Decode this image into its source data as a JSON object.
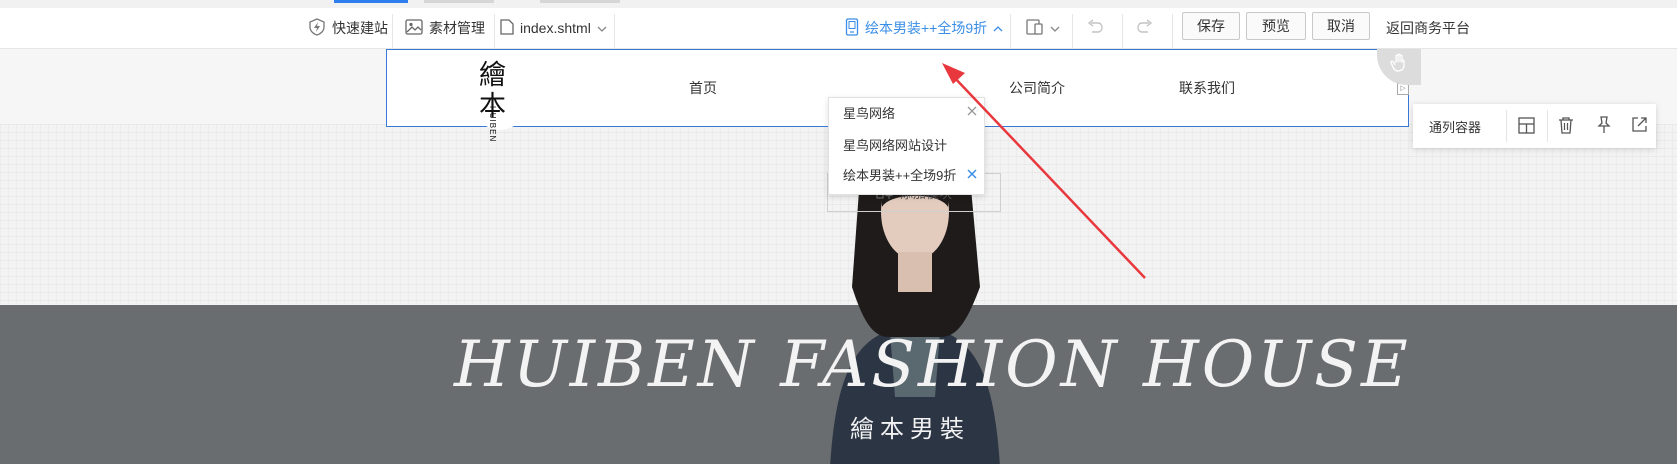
{
  "toolbar": {
    "quick_build": "快速建站",
    "asset_manage": "素材管理",
    "file_name": "index.shtml",
    "page_selector": "绘本男装++全场9折",
    "save": "保存",
    "preview": "预览",
    "cancel": "取消",
    "return": "返回商务平台"
  },
  "dropdown": {
    "items": [
      {
        "label": "星鸟网络"
      },
      {
        "label": "星鸟网络网站设计"
      },
      {
        "label": "绘本男装++全场9折"
      }
    ]
  },
  "page": {
    "nav": [
      "首页",
      "公司简介",
      "联系我们"
    ],
    "logo_text_cn": "繪本",
    "logo_text_en": "HUIBEN",
    "add_module": "添加模块",
    "hero_title": "HUIBEN FASHION HOUSE",
    "hero_subtitle": "繪本男裝"
  },
  "float_panel": {
    "label": "通列容器",
    "icons": [
      "layout-icon",
      "trash-icon",
      "pin-icon",
      "external-link-icon"
    ]
  },
  "colors": {
    "accent": "#3a8ee6",
    "selection_border": "#3a78d8",
    "arrow": "#e8383d",
    "hero_bg": "#6a6d70"
  }
}
